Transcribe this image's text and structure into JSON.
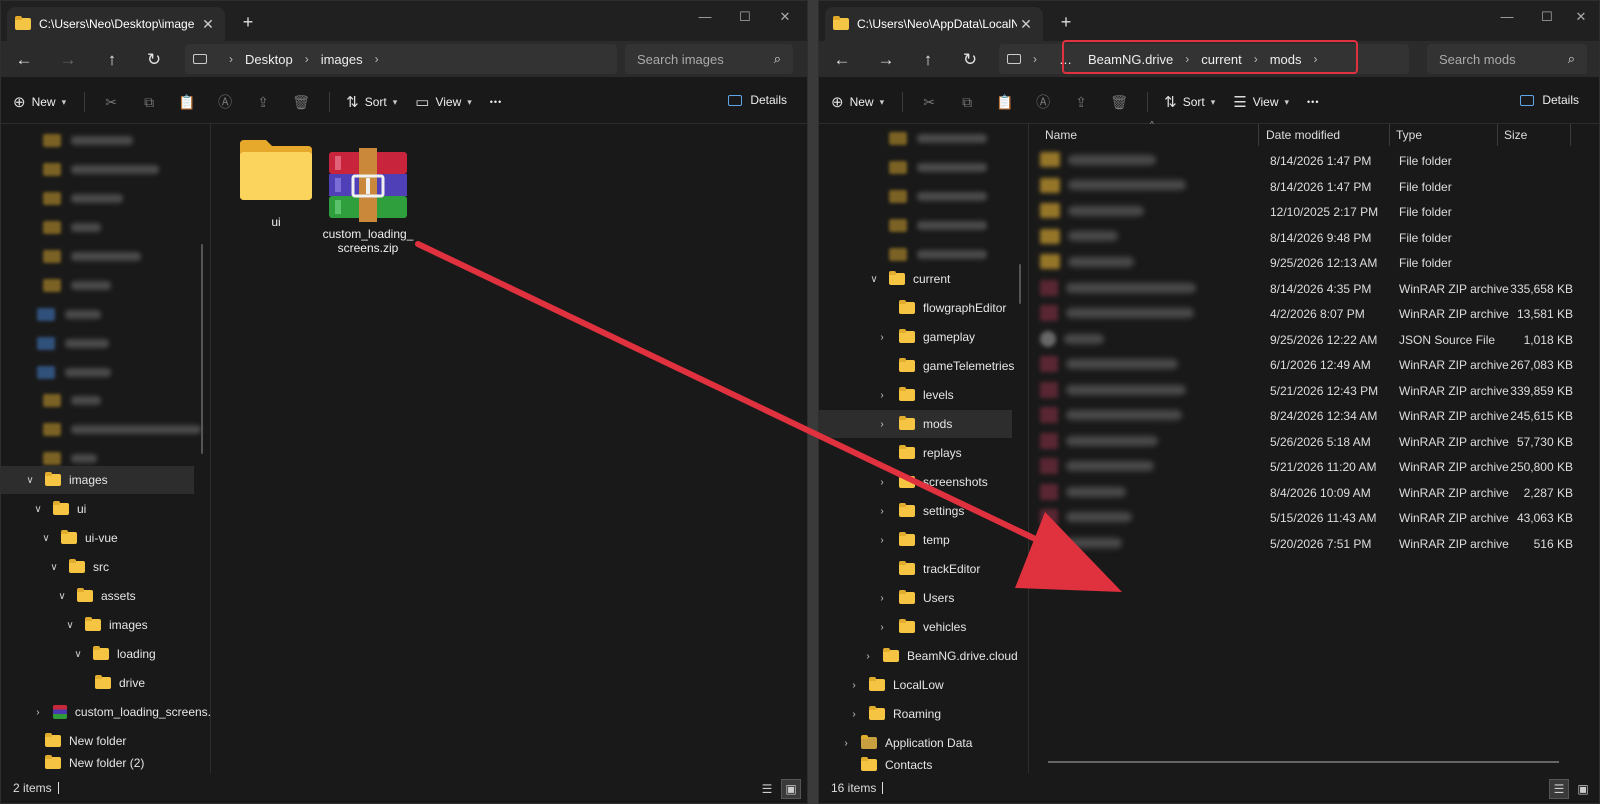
{
  "left": {
    "tab_title": "C:\\Users\\Neo\\Desktop\\image",
    "breadcrumb": [
      "Desktop",
      "images"
    ],
    "search_placeholder": "Search images",
    "toolbar": {
      "new": "New",
      "sort": "Sort",
      "view": "View",
      "more": "•••",
      "details": "Details"
    },
    "tree": [
      {
        "label": "images",
        "arrow": "∨"
      },
      {
        "label": "ui",
        "arrow": "∨"
      },
      {
        "label": "ui-vue",
        "arrow": "∨"
      },
      {
        "label": "src",
        "arrow": "∨"
      },
      {
        "label": "assets",
        "arrow": "∨"
      },
      {
        "label": "images",
        "arrow": "∨"
      },
      {
        "label": "loading",
        "arrow": "∨"
      },
      {
        "label": "drive",
        "arrow": ""
      },
      {
        "label": "custom_loading_screens.",
        "arrow": "›"
      },
      {
        "label": "New folder",
        "arrow": ""
      },
      {
        "label": "New folder (2)",
        "arrow": ""
      }
    ],
    "items": [
      {
        "name": "ui",
        "type": "folder"
      },
      {
        "name": "custom_loading_\nscreens.zip",
        "type": "zip"
      }
    ],
    "status": "2 items"
  },
  "right": {
    "tab_title": "C:\\Users\\Neo\\AppData\\LocalN",
    "breadcrumb_ellipsis": "…",
    "breadcrumb": [
      "BeamNG.drive",
      "current",
      "mods"
    ],
    "search_placeholder": "Search mods",
    "toolbar": {
      "new": "New",
      "sort": "Sort",
      "view": "View",
      "more": "•••",
      "details": "Details"
    },
    "tree": [
      {
        "label": "current",
        "arrow": "∨"
      },
      {
        "label": "flowgraphEditor",
        "arrow": ""
      },
      {
        "label": "gameplay",
        "arrow": "›"
      },
      {
        "label": "gameTelemetries",
        "arrow": ""
      },
      {
        "label": "levels",
        "arrow": "›"
      },
      {
        "label": "mods",
        "arrow": "›"
      },
      {
        "label": "replays",
        "arrow": ""
      },
      {
        "label": "screenshots",
        "arrow": "›"
      },
      {
        "label": "settings",
        "arrow": "›"
      },
      {
        "label": "temp",
        "arrow": "›"
      },
      {
        "label": "trackEditor",
        "arrow": ""
      },
      {
        "label": "Users",
        "arrow": "›"
      },
      {
        "label": "vehicles",
        "arrow": "›"
      },
      {
        "label": "BeamNG.drive.cloud",
        "arrow": "›"
      },
      {
        "label": "LocalLow",
        "arrow": "›"
      },
      {
        "label": "Roaming",
        "arrow": "›"
      },
      {
        "label": "Application Data",
        "arrow": "›"
      },
      {
        "label": "Contacts",
        "arrow": ""
      }
    ],
    "columns": {
      "name": "Name",
      "date": "Date modified",
      "type": "Type",
      "size": "Size"
    },
    "files": [
      {
        "kind": "folder",
        "date": "8/14/2026 1:47 PM",
        "type": "File folder",
        "size": ""
      },
      {
        "kind": "folder",
        "date": "8/14/2026 1:47 PM",
        "type": "File folder",
        "size": ""
      },
      {
        "kind": "folder",
        "date": "12/10/2025 2:17 PM",
        "type": "File folder",
        "size": ""
      },
      {
        "kind": "folder",
        "date": "8/14/2026 9:48 PM",
        "type": "File folder",
        "size": ""
      },
      {
        "kind": "folder",
        "date": "9/25/2026 12:13 AM",
        "type": "File folder",
        "size": ""
      },
      {
        "kind": "zip",
        "date": "8/14/2026 4:35 PM",
        "type": "WinRAR ZIP archive",
        "size": "335,658 KB"
      },
      {
        "kind": "zip",
        "date": "4/2/2026 8:07 PM",
        "type": "WinRAR ZIP archive",
        "size": "13,581 KB"
      },
      {
        "kind": "json",
        "date": "9/25/2026 12:22 AM",
        "type": "JSON Source File",
        "size": "1,018 KB"
      },
      {
        "kind": "zip",
        "date": "6/1/2026 12:49 AM",
        "type": "WinRAR ZIP archive",
        "size": "267,083 KB"
      },
      {
        "kind": "zip",
        "date": "5/21/2026 12:43 PM",
        "type": "WinRAR ZIP archive",
        "size": "339,859 KB"
      },
      {
        "kind": "zip",
        "date": "8/24/2026 12:34 AM",
        "type": "WinRAR ZIP archive",
        "size": "245,615 KB"
      },
      {
        "kind": "zip",
        "date": "5/26/2026 5:18 AM",
        "type": "WinRAR ZIP archive",
        "size": "57,730 KB"
      },
      {
        "kind": "zip",
        "date": "5/21/2026 11:20 AM",
        "type": "WinRAR ZIP archive",
        "size": "250,800 KB"
      },
      {
        "kind": "zip",
        "date": "8/4/2026 10:09 AM",
        "type": "WinRAR ZIP archive",
        "size": "2,287 KB"
      },
      {
        "kind": "zip",
        "date": "5/15/2026 11:43 AM",
        "type": "WinRAR ZIP archive",
        "size": "43,063 KB"
      },
      {
        "kind": "zip",
        "date": "5/20/2026 7:51 PM",
        "type": "WinRAR ZIP archive",
        "size": "516 KB"
      }
    ],
    "status": "16 items"
  },
  "colors": {
    "arrow": "#e0313f",
    "folder": "#f5c442",
    "accent": "#5ea6e8"
  }
}
